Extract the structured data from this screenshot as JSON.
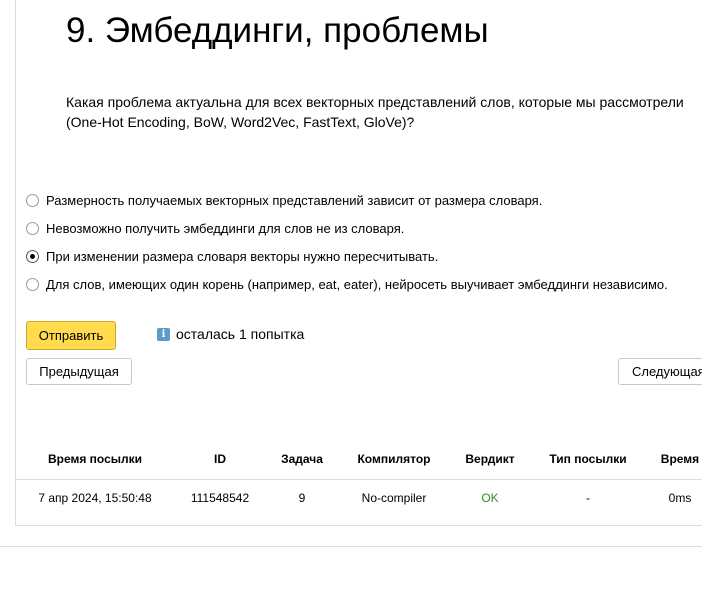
{
  "title": "9. Эмбеддинги, проблемы",
  "question": "Какая проблема актуальна для всех векторных представлений слов, которые мы рассмотрели (One-Hot Encoding, BoW, Word2Vec, FastText, GloVe)?",
  "options": [
    {
      "label": "Размерность получаемых векторных представлений зависит от размера словаря.",
      "checked": false
    },
    {
      "label": "Невозможно получить эмбеддинги для слов не из словаря.",
      "checked": false
    },
    {
      "label": "При изменении размера словаря векторы нужно пересчитывать.",
      "checked": true
    },
    {
      "label": "Для слов, имеющих один корень (например, eat, eater), нейросеть выучивает эмбеддинги независимо.",
      "checked": false
    }
  ],
  "buttons": {
    "submit": "Отправить",
    "prev": "Предыдущая",
    "next": "Следующая"
  },
  "attempts": {
    "icon": "info-icon",
    "text": "осталась 1 попытка"
  },
  "submissions": {
    "headers": {
      "time": "Время посылки",
      "id": "ID",
      "task": "Задача",
      "compiler": "Компилятор",
      "verdict": "Вердикт",
      "type": "Тип посылки",
      "duration": "Время"
    },
    "rows": [
      {
        "time": "7 апр 2024, 15:50:48",
        "id": "111548542",
        "task": "9",
        "compiler": "No-compiler",
        "verdict": "OK",
        "type": "-",
        "duration": "0ms"
      }
    ]
  },
  "colors": {
    "submit_button": "#ffdb4d",
    "verdict_ok": "#3a8a27",
    "info_icon": "#5b9bc9"
  }
}
